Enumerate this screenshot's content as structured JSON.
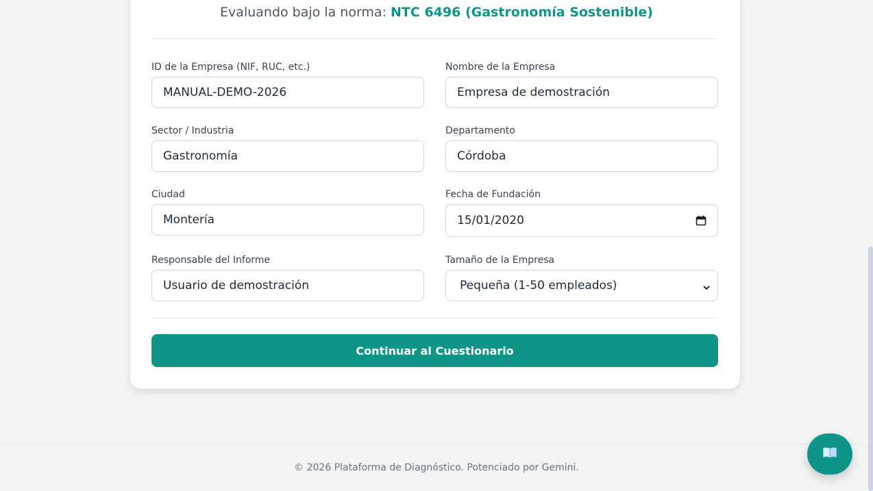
{
  "header": {
    "norm_prefix": "Evaluando bajo la norma:",
    "norm_name": "NTC 6496 (Gastronomía Sostenible)"
  },
  "form": {
    "company_id": {
      "label": "ID de la Empresa (NIF, RUC, etc.)",
      "value": "MANUAL-DEMO-2026"
    },
    "company_name": {
      "label": "Nombre de la Empresa",
      "value": "Empresa de demostración"
    },
    "sector": {
      "label": "Sector / Industria",
      "value": "Gastronomía"
    },
    "department": {
      "label": "Departamento",
      "value": "Córdoba"
    },
    "city": {
      "label": "Ciudad",
      "value": "Montería"
    },
    "founding_date": {
      "label": "Fecha de Fundación",
      "value": "15/01/2020"
    },
    "report_owner": {
      "label": "Responsable del Informe",
      "value": "Usuario de demostración"
    },
    "company_size": {
      "label": "Tamaño de la Empresa",
      "value": "Pequeña (1-50 empleados)"
    },
    "submit_label": "Continuar al Cuestionario"
  },
  "footer": {
    "text": "© 2026 Plataforma de Diagnóstico. Potenciado por Gemini."
  },
  "colors": {
    "accent": "#0e9488",
    "background": "#f3f4f6",
    "card": "#ffffff",
    "border": "#d1d5db"
  },
  "icons": {
    "date_field": "calendar-icon",
    "select_field": "chevron-down-icon",
    "help_button": "book-icon"
  }
}
